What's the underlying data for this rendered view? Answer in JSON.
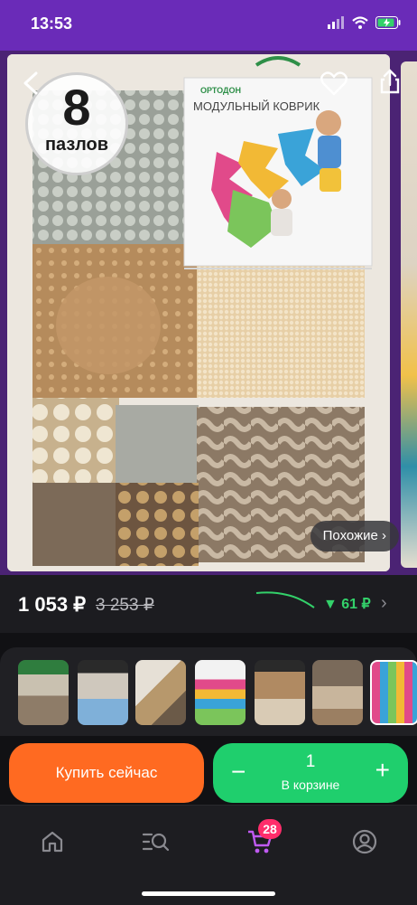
{
  "status": {
    "time": "13:53"
  },
  "hero": {
    "badge_number": "8",
    "badge_text": "пазлов",
    "box_brand": "ОРТОДОН",
    "box_title": "МОДУЛЬНЫЙ КОВРИК",
    "similar_label": "Похожие ›"
  },
  "price": {
    "current": "1 053 ₽",
    "old": "3 253 ₽",
    "drop": "▼ 61 ₽",
    "chevron": "›"
  },
  "actions": {
    "buy_label": "Купить сейчас",
    "quantity": "1",
    "in_cart_label": "В корзине",
    "minus": "−",
    "plus": "+"
  },
  "tabbar": {
    "cart_count": "28"
  },
  "colors": {
    "accent": "#6a2bb8",
    "buy": "#ff6a21",
    "cart": "#1fcf6d",
    "badge": "#ff2d6b"
  }
}
